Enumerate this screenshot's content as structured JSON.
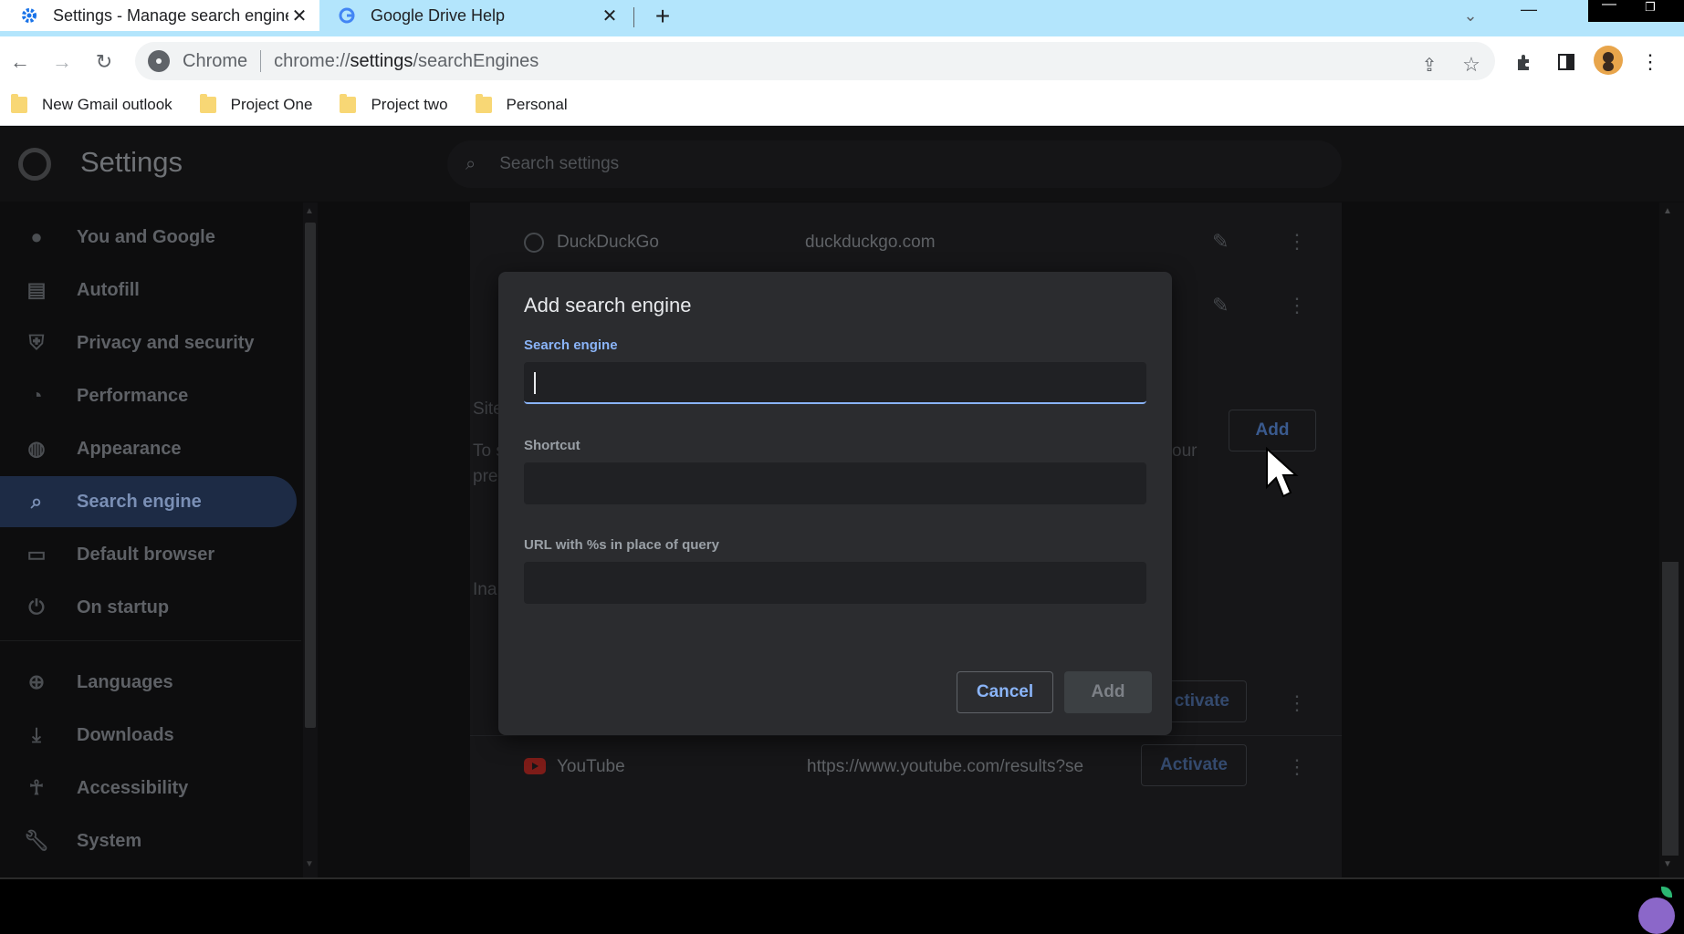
{
  "browser": {
    "tabs": [
      {
        "title": "Settings - Manage search engine",
        "icon": "gear-icon"
      },
      {
        "title": "Google Drive Help",
        "icon": "google-g-icon"
      }
    ],
    "close_glyph": "✕",
    "new_tab_glyph": "+",
    "omnibox": {
      "site_label": "Chrome",
      "url_prefix": "chrome://",
      "url_host": "settings",
      "url_path": "/searchEngines"
    },
    "bookmarks": [
      "New Gmail outlook",
      "Project One",
      "Project two",
      "Personal"
    ]
  },
  "settings": {
    "title": "Settings",
    "search_placeholder": "Search settings",
    "nav": [
      {
        "label": "You and Google",
        "icon": "person-icon"
      },
      {
        "label": "Autofill",
        "icon": "clipboard-icon"
      },
      {
        "label": "Privacy and security",
        "icon": "shield-icon"
      },
      {
        "label": "Performance",
        "icon": "speedometer-icon"
      },
      {
        "label": "Appearance",
        "icon": "palette-icon"
      },
      {
        "label": "Search engine",
        "icon": "search-icon",
        "active": true
      },
      {
        "label": "Default browser",
        "icon": "browser-icon"
      },
      {
        "label": "On startup",
        "icon": "power-icon"
      },
      {
        "label": "Languages",
        "icon": "globe-icon"
      },
      {
        "label": "Downloads",
        "icon": "download-icon"
      },
      {
        "label": "Accessibility",
        "icon": "accessibility-icon"
      },
      {
        "label": "System",
        "icon": "wrench-icon"
      }
    ]
  },
  "search_engines": {
    "duckduckgo": {
      "name": "DuckDuckGo",
      "keyword": "duckduckgo.com"
    },
    "site_search_partial": "Site",
    "desc_partial_1": "To s",
    "desc_partial_2": "pre",
    "desc_partial_right": "our",
    "add_label": "Add",
    "inactive_partial": "Ina",
    "activate_partial": "ctivate",
    "youtube": {
      "name": "YouTube",
      "url": "https://www.youtube.com/results?se",
      "action": "Activate"
    }
  },
  "dialog": {
    "title": "Add search engine",
    "field_engine_label": "Search engine",
    "field_shortcut_label": "Shortcut",
    "field_url_label": "URL with %s in place of query",
    "field_engine_value": "",
    "field_shortcut_value": "",
    "field_url_value": "",
    "cancel_label": "Cancel",
    "add_label": "Add"
  },
  "colors": {
    "accent": "#8ab4f8",
    "active_nav_bg": "#1d2b45",
    "dialog_bg": "#2b2c2f"
  }
}
